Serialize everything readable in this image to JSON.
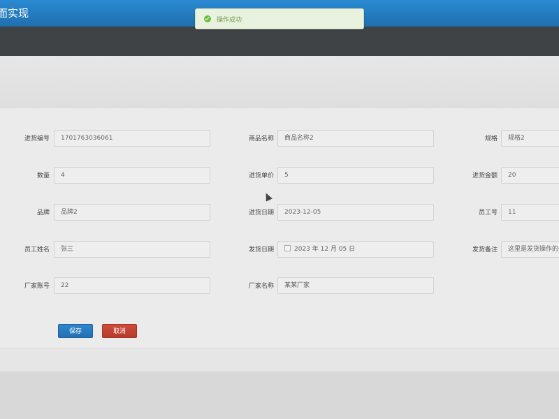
{
  "app": {
    "title": "面实现"
  },
  "toast": {
    "message": "操作成功"
  },
  "form": {
    "fields": [
      {
        "label": "进货编号",
        "value": "1701763036061"
      },
      {
        "label": "商品名称",
        "value": "商品名称2"
      },
      {
        "label": "规格",
        "value": "规格2"
      },
      {
        "label": "数量",
        "value": "4"
      },
      {
        "label": "进货单价",
        "value": "5"
      },
      {
        "label": "进货金额",
        "value": "20"
      },
      {
        "label": "品牌",
        "value": "品牌2"
      },
      {
        "label": "进货日期",
        "value": "2023-12-05"
      },
      {
        "label": "员工号",
        "value": "11"
      },
      {
        "label": "员工姓名",
        "value": "张三"
      },
      {
        "label": "发货日期",
        "value": "2023 年 12 月 05 日"
      },
      {
        "label": "发货备注",
        "value": "这里是发货操作的备注"
      },
      {
        "label": "厂家账号",
        "value": "22"
      },
      {
        "label": "厂家名称",
        "value": "某某厂家"
      }
    ]
  },
  "buttons": {
    "save": "保存",
    "cancel": "取消"
  },
  "icons": {
    "toast": "check-circle-icon",
    "date": "calendar-icon",
    "cursor": "mouse-pointer-icon"
  },
  "colors": {
    "primary": "#2370b4",
    "danger": "#b63c2c",
    "success": "#6abf3b"
  }
}
